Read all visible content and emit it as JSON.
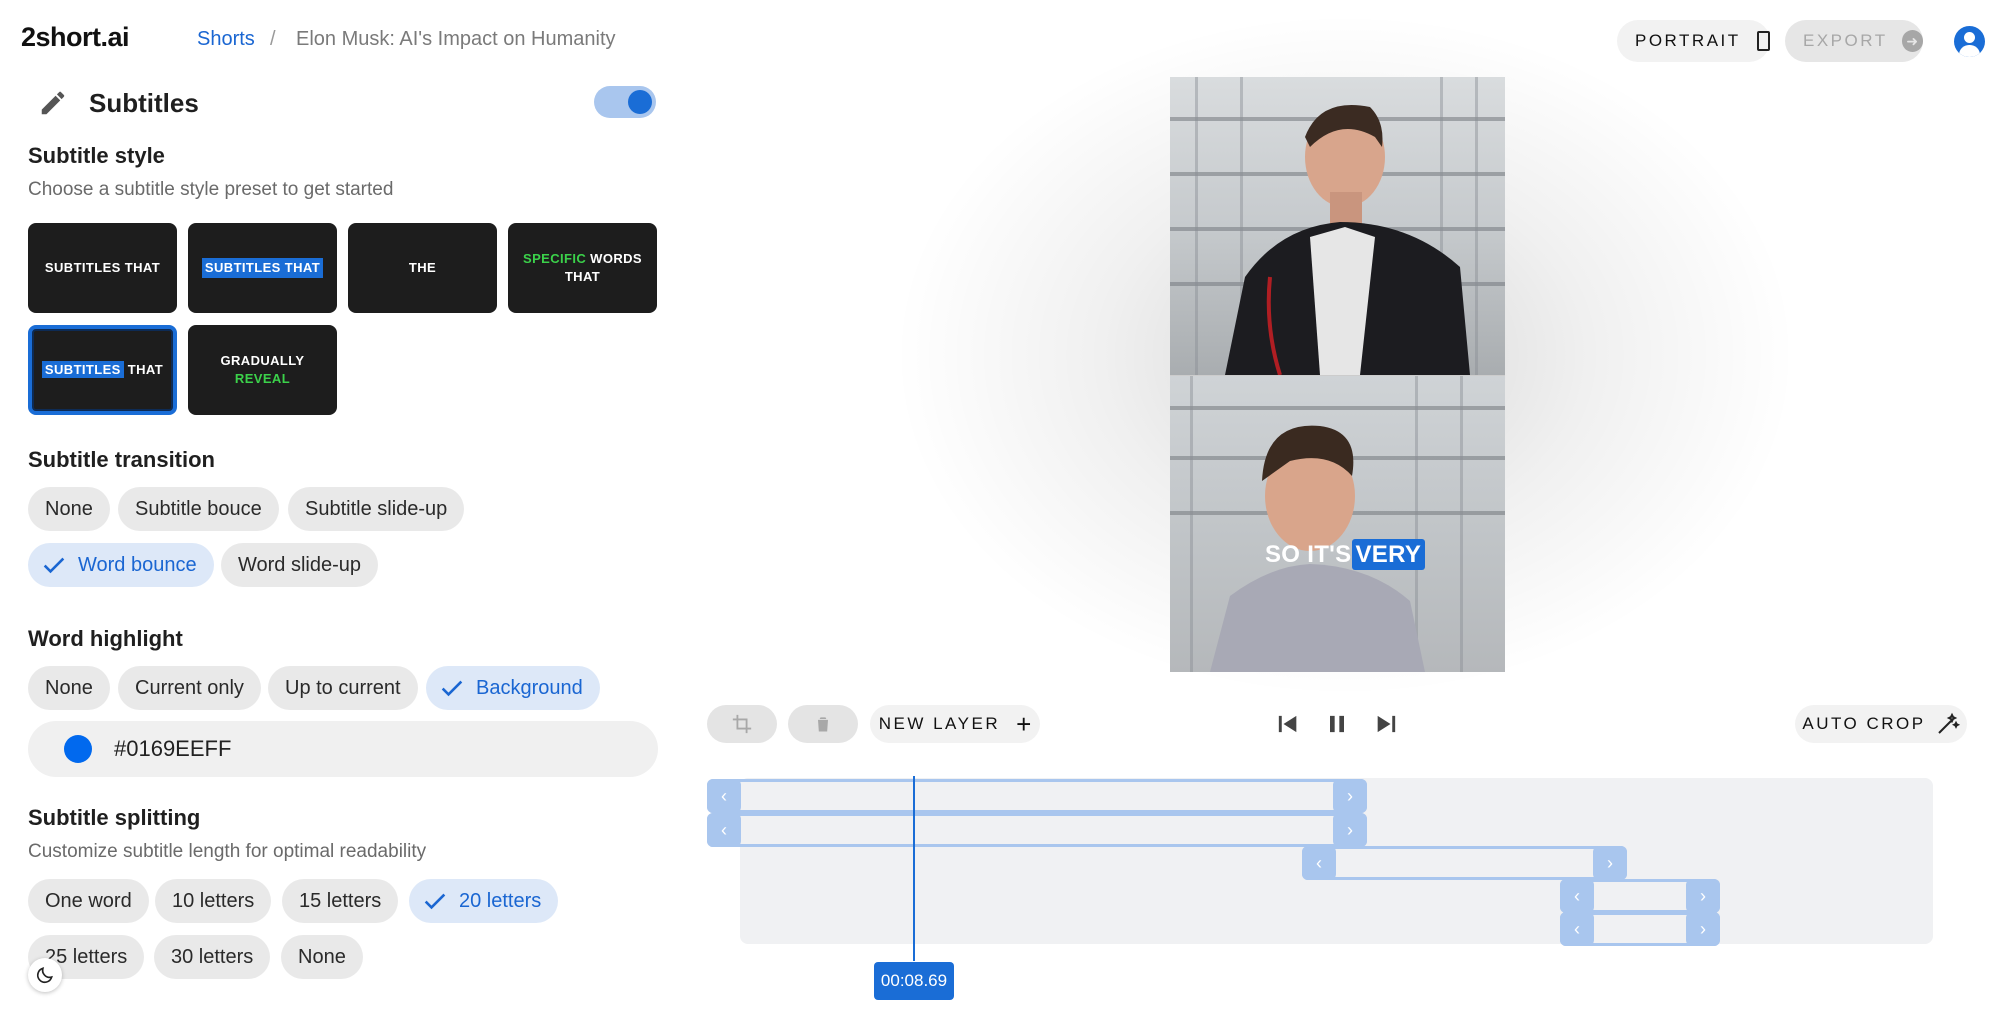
{
  "header": {
    "logo": "2short.ai",
    "breadcrumb": {
      "link": "Shorts",
      "separator": "/",
      "current": "Elon Musk: AI's Impact on Humanity"
    },
    "portrait_label": "PORTRAIT",
    "export_label": "EXPORT"
  },
  "subtitles": {
    "title": "Subtitles",
    "enabled": true,
    "style": {
      "heading": "Subtitle style",
      "subheading": "Choose a subtitle style preset to get started",
      "presets": [
        {
          "parts": [
            "SUBTITLES THAT"
          ]
        },
        {
          "parts": [
            "SUBTITLES THAT"
          ]
        },
        {
          "parts": [
            "THE"
          ]
        },
        {
          "parts": [
            "SPECIFIC",
            " WORDS",
            "THAT"
          ]
        },
        {
          "parts": [
            "SUBTITLES",
            " THAT"
          ],
          "selected": true
        },
        {
          "parts": [
            "GRADUALLY",
            "REVEAL"
          ]
        }
      ]
    },
    "transition": {
      "heading": "Subtitle transition",
      "options": [
        "None",
        "Subtitle bouce",
        "Subtitle slide-up",
        "Word bounce",
        "Word slide-up"
      ],
      "selected": "Word bounce"
    },
    "highlight": {
      "heading": "Word highlight",
      "options": [
        "None",
        "Current only",
        "Up to current",
        "Background"
      ],
      "selected": "Background",
      "color_value": "#0169EEFF",
      "color": "#0169EE"
    },
    "splitting": {
      "heading": "Subtitle splitting",
      "subheading": "Customize subtitle length for optimal readability",
      "options": [
        "One word",
        "10 letters",
        "15 letters",
        "20 letters",
        "25 letters",
        "30 letters",
        "None"
      ],
      "selected": "20 letters"
    }
  },
  "preview": {
    "caption_plain": "SO IT'S",
    "caption_highlight": "VERY"
  },
  "controls": {
    "new_layer_label": "NEW LAYER",
    "auto_crop_label": "AUTO CROP"
  },
  "timeline": {
    "current_time": "00:08.69"
  },
  "colors": {
    "accent": "#1a6dd6",
    "accent_light": "#a9c6ee",
    "highlight_green": "#3bd14a"
  }
}
